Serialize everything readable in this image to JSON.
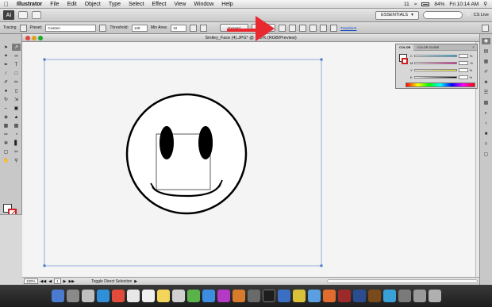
{
  "menubar": {
    "app_name": "Illustrator",
    "items": [
      "File",
      "Edit",
      "Object",
      "Type",
      "Select",
      "Effect",
      "View",
      "Window",
      "Help"
    ],
    "status_items": [
      "11",
      "84%",
      "Fri 10:14 AM"
    ]
  },
  "appbar": {
    "logo": "Ai",
    "workspace_label": "ESSENTIALS",
    "cs_live_label": "CS Live"
  },
  "control": {
    "label": "Tracing",
    "preset_label": "Preset:",
    "preset_value": "Custom",
    "threshold_label": "Threshold:",
    "threshold_value": "128",
    "min_area_label": "Min Area:",
    "min_area_value": "10",
    "expand_label": "Expand",
    "live_paint_label": "Live Paint",
    "transform_label": "Transform"
  },
  "document": {
    "tab_title": "Smiley_Face (4).JPG* @ 100% (RGB/Preview)",
    "zoom_value": "100%",
    "page_value": "1",
    "status_text": "Toggle Direct Selection"
  },
  "color_panel": {
    "tab_color": "COLOR",
    "tab_guide": "COLOR GUIDE",
    "channels": [
      "C",
      "M",
      "Y",
      "K"
    ],
    "percent": "%"
  },
  "colors": {
    "accent_red": "#cc2222",
    "annotation_arrow": "#e8292f",
    "selection_blue": "#4a78c8"
  },
  "icons": {
    "menubar": [
      "apple-icon",
      "wifi-icon",
      "battery-icon",
      "search-icon"
    ],
    "tools": [
      "selection-tool",
      "direct-selection-tool",
      "magic-wand-tool",
      "lasso-tool",
      "pen-tool",
      "type-tool",
      "line-tool",
      "rectangle-tool",
      "paintbrush-tool",
      "pencil-tool",
      "blob-brush-tool",
      "eraser-tool",
      "rotate-tool",
      "scale-tool",
      "width-tool",
      "free-transform-tool",
      "shape-builder-tool",
      "perspective-tool",
      "mesh-tool",
      "gradient-tool",
      "eyedropper-tool",
      "blend-tool",
      "symbol-sprayer-tool",
      "graph-tool",
      "artboard-tool",
      "slice-tool",
      "hand-tool",
      "zoom-tool"
    ]
  }
}
